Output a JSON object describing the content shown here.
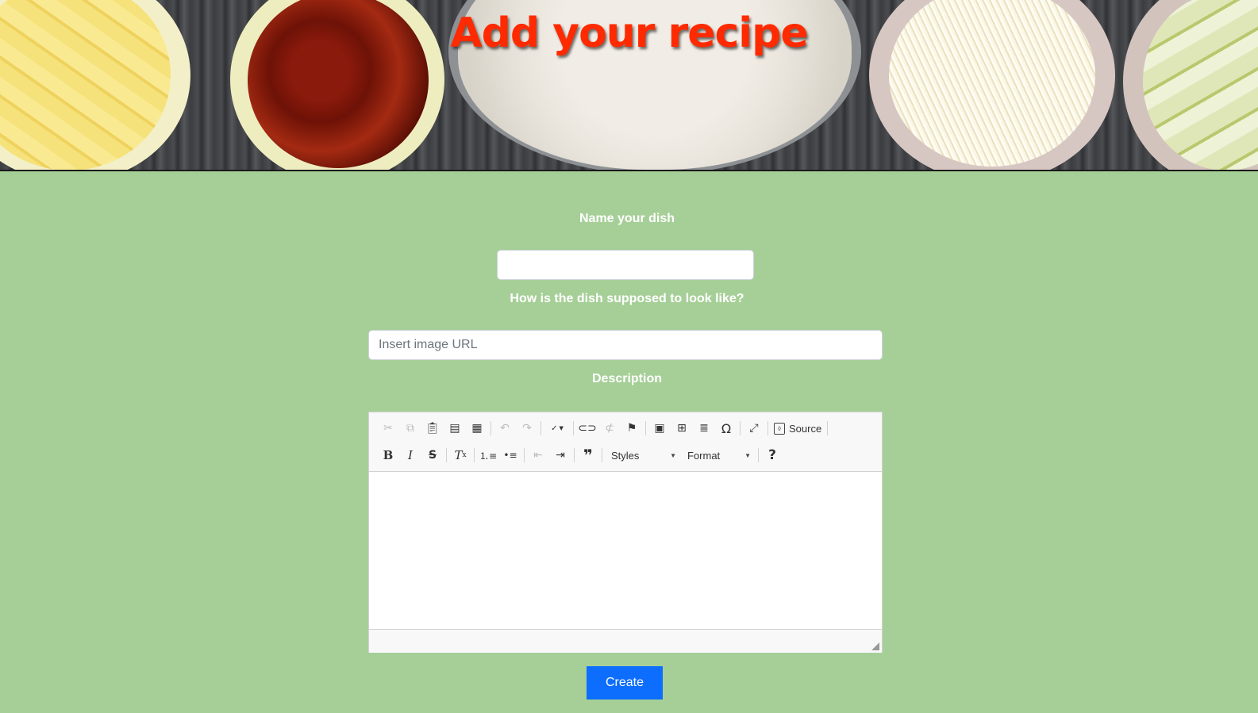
{
  "header": {
    "title": "Add your recipe"
  },
  "form": {
    "name_label": "Name your dish",
    "name_value": "",
    "image_label": "How is the dish supposed to look like?",
    "image_placeholder": "Insert image URL",
    "description_label": "Description",
    "submit_label": "Create"
  },
  "editor": {
    "toolbar_row1": [
      {
        "icon": "cut-icon",
        "enabled": false
      },
      {
        "icon": "copy-icon",
        "enabled": false
      },
      {
        "icon": "paste-icon",
        "enabled": true
      },
      {
        "icon": "paste-text-icon",
        "enabled": true
      },
      {
        "icon": "paste-from-word-icon",
        "enabled": true
      },
      {
        "icon": "undo-icon",
        "enabled": false
      },
      {
        "icon": "redo-icon",
        "enabled": false
      },
      {
        "icon": "spellcheck-icon",
        "enabled": true
      },
      {
        "icon": "link-icon",
        "enabled": true
      },
      {
        "icon": "unlink-icon",
        "enabled": false
      },
      {
        "icon": "anchor-icon",
        "enabled": true
      },
      {
        "icon": "image-icon",
        "enabled": true
      },
      {
        "icon": "table-icon",
        "enabled": true
      },
      {
        "icon": "horizontal-line-icon",
        "enabled": true
      },
      {
        "icon": "special-char-icon",
        "enabled": true
      },
      {
        "icon": "maximize-icon",
        "enabled": true
      }
    ],
    "source_label": "Source",
    "toolbar_row2": [
      {
        "icon": "bold-icon",
        "enabled": true
      },
      {
        "icon": "italic-icon",
        "enabled": true
      },
      {
        "icon": "strikethrough-icon",
        "enabled": true
      },
      {
        "icon": "remove-format-icon",
        "enabled": true
      },
      {
        "icon": "numbered-list-icon",
        "enabled": true
      },
      {
        "icon": "bulleted-list-icon",
        "enabled": true
      },
      {
        "icon": "outdent-icon",
        "enabled": false
      },
      {
        "icon": "indent-icon",
        "enabled": true
      },
      {
        "icon": "blockquote-icon",
        "enabled": true
      }
    ],
    "styles_label": "Styles",
    "format_label": "Format",
    "help_icon": "help-icon",
    "content": ""
  },
  "colors": {
    "page_background": "#a6cf97",
    "title_color": "#ff2a00",
    "button_color": "#0d6efd"
  }
}
